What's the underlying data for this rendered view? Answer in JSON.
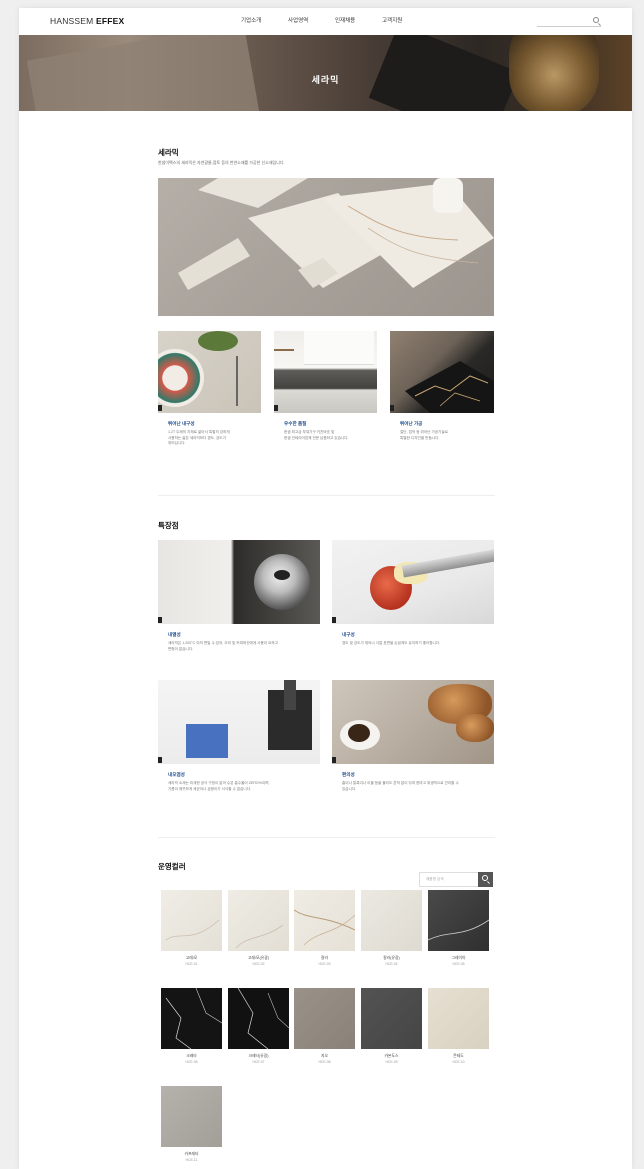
{
  "header": {
    "logo_light": "HANSSEM ",
    "logo_bold": "EFFEX",
    "nav": [
      "기업소개",
      "사업영역",
      "인재채용",
      "고객지원"
    ]
  },
  "hero": {
    "title": "세라믹"
  },
  "intro": {
    "title": "세라믹",
    "desc": "한샘이펙스의 세라믹은 자연광물,점토 등의 천연소재를 가공한 신소재입니다."
  },
  "features": [
    {
      "title": "뛰어난 내구성",
      "text": "1,2T 두께의 자체로 얇아서 특별히 강하게\n사용하는 얇은 세라믹보다 경도, 강도가\n뛰어납니다."
    },
    {
      "title": "우수한 품질",
      "text": "한샘 최고급 부엌가구 키친바흐 및\n한샘 인테리어업체 전문 납품하고 있습니다."
    },
    {
      "title": "뛰어난 가공",
      "text": "절단, 접착 등 뛰어난 가공기술로\n특별한 디자인을 만듭니다."
    }
  ],
  "specialty": {
    "title": "특장점",
    "items": [
      {
        "title": "내열성",
        "text": "세라믹은 1,200°C 이의 면일 수 있어, 조리 및 커피머신에게 사용이 요하고\n변형이 없습니다."
      },
      {
        "title": "내구성",
        "text": "경도 및 강도가 뛰어나 식칼 표면을 손쉽게도 유지하기 좋아합니다."
      },
      {
        "title": "내오염성",
        "text": "세라믹 소재는 미세한 공극 구멍이 없어 수분 흡수율이 ZERO%이며,\n기름이 깨끗하게 세균이나 곰팡이가 서식할 수 없습니다."
      },
      {
        "title": "편의성",
        "text": "흠이나 얼룩이나 이물 등을 물리도 흔적 없이 닦여 한마고 위생적으로 관리할 수\n있습니다."
      }
    ]
  },
  "gallery": {
    "title": "운영컬러",
    "search_placeholder": "제품명 검색",
    "items": [
      {
        "name": "고레/모",
        "code": "HCE-01"
      },
      {
        "name": "고레/모(유광)",
        "code": "HCE-02"
      },
      {
        "name": "칼라",
        "code": "HCE-03"
      },
      {
        "name": "칼라(유광)",
        "code": "HCE-04"
      },
      {
        "name": "그레이아",
        "code": "HCE-05"
      },
      {
        "name": "크레타",
        "code": "HCE-06"
      },
      {
        "name": "크레타(유광)",
        "code": "HCE-07"
      },
      {
        "name": "지오",
        "code": "HCE-08"
      },
      {
        "name": "카본도스",
        "code": "HCE-09"
      },
      {
        "name": "몬테도",
        "code": "HCE-10"
      },
      {
        "name": "카프레타",
        "code": "HCE-11"
      }
    ]
  },
  "colors": {
    "accent": "#1a4a8c"
  },
  "icons": {
    "search": "search-icon"
  }
}
